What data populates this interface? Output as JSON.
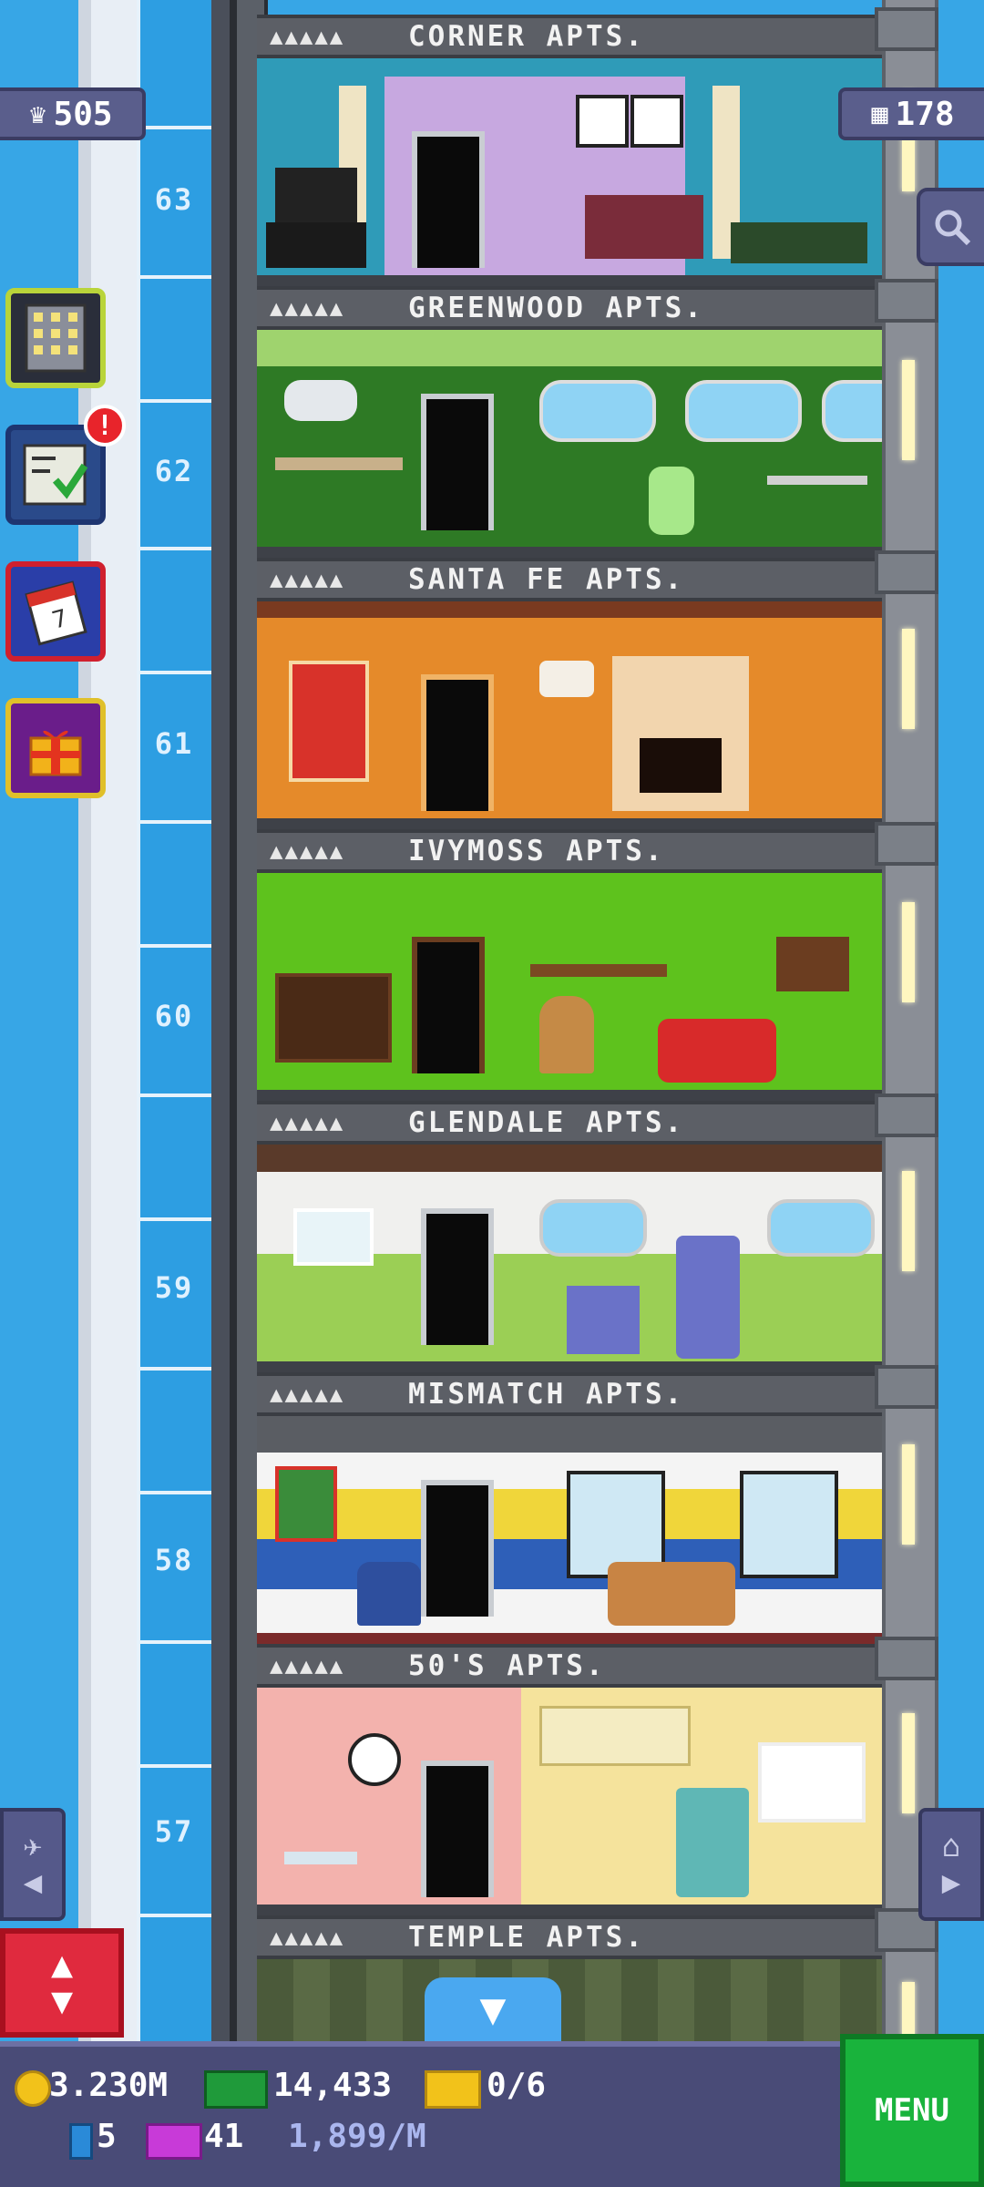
{
  "hud": {
    "population": "505",
    "floors": "178"
  },
  "floors": [
    {
      "name": "CORNER APTS.",
      "number": "63",
      "wall": "#2f9bb8",
      "accent": "#c7a8e0"
    },
    {
      "name": "GREENWOOD APTS.",
      "number": "62",
      "wall": "#2e7a25",
      "accent": "#9fd36e"
    },
    {
      "name": "SANTA FE APTS.",
      "number": "61",
      "wall": "#e58a2a",
      "accent": "#f2b56a"
    },
    {
      "name": "IVYMOSS APTS.",
      "number": "60",
      "wall": "#5ec21d",
      "accent": "#88de3c"
    },
    {
      "name": "GLENDALE APTS.",
      "number": "59",
      "wall": "#f0f0ee",
      "accent": "#9bcf55"
    },
    {
      "name": "MISMATCH APTS.",
      "number": "58",
      "wall": "#f4f4f4",
      "accent": "#f0d63a"
    },
    {
      "name": "50'S APTS.",
      "number": "57",
      "wall": "#f3b2ad",
      "accent": "#f5e39c"
    },
    {
      "name": "TEMPLE APTS.",
      "number": "",
      "wall": "#4b5a3a",
      "accent": "#6b7a4f"
    }
  ],
  "stars": "▲▲▲▲▲",
  "bottom": {
    "coins": "3.230M",
    "bux": "14,433",
    "tickets": "0/6",
    "keys": "5",
    "vip": "41",
    "rate": "1,899/M",
    "menu": "MENU"
  },
  "icons": {
    "population": "person-icon",
    "floors": "building-icon",
    "search": "magnifier-icon",
    "elevator": "up-down-arrows-icon",
    "down": "down-arrow-icon",
    "nav_left": "airplane-left-icon",
    "nav_right": "home-right-icon"
  },
  "alerts": {
    "missions_badge": "!"
  }
}
